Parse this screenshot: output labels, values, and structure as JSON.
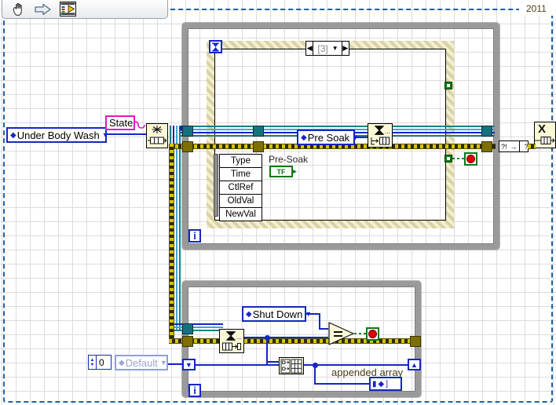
{
  "window": {
    "version_tag": "2011",
    "toolbar": {
      "icons": [
        {
          "name": "hand-tool-icon",
          "glyph": "hand"
        },
        {
          "name": "run-arrow-icon",
          "glyph": "arrow"
        },
        {
          "name": "connector-pane-icon",
          "glyph": "vi"
        }
      ]
    }
  },
  "diagram": {
    "controls": {
      "state_enum": {
        "label": "Under Body Wash",
        "name_label": "State"
      },
      "pre_soak_enum": {
        "label": "Pre Soak"
      },
      "shut_down_enum": {
        "label": "Shut Down"
      },
      "default_enum": {
        "label": "Default"
      },
      "numeric_constant": {
        "value": "0"
      }
    },
    "event_structure": {
      "case_selector": {
        "value": "[3]",
        "left_arrow": "◀",
        "right_arrow": "▶",
        "down_arrow": "▼"
      },
      "event_data_node": {
        "items": [
          "Type",
          "Time",
          "CtlRef",
          "OldVal",
          "NewVal"
        ]
      },
      "event_source": {
        "label": "Pre-Soak",
        "terminal_text": "TF"
      },
      "timeout_terminal": {
        "name": "timeout-terminal"
      }
    },
    "nodes": {
      "bundle_node": {
        "name": "bundle-cluster-node"
      },
      "enqueue_node_1": {
        "name": "enqueue-element-node"
      },
      "dequeue_node": {
        "name": "dequeue-element-node"
      },
      "release_queue_node": {
        "name": "release-queue-node"
      },
      "build_array_node": {
        "name": "build-array-node"
      },
      "equal_node": {
        "name": "equal-comparison-node",
        "symbol": "="
      },
      "error_merge": {
        "left": "?!",
        "arrow": "→",
        "right": "?!"
      }
    },
    "indicators": {
      "appended_array": {
        "label": "appended array"
      },
      "stop_button_top": {
        "name": "stop-button-terminal"
      },
      "stop_button_bottom": {
        "name": "stop-button-terminal"
      }
    },
    "loop_terminals": {
      "iteration_top": "i",
      "iteration_bottom": "i"
    }
  }
}
